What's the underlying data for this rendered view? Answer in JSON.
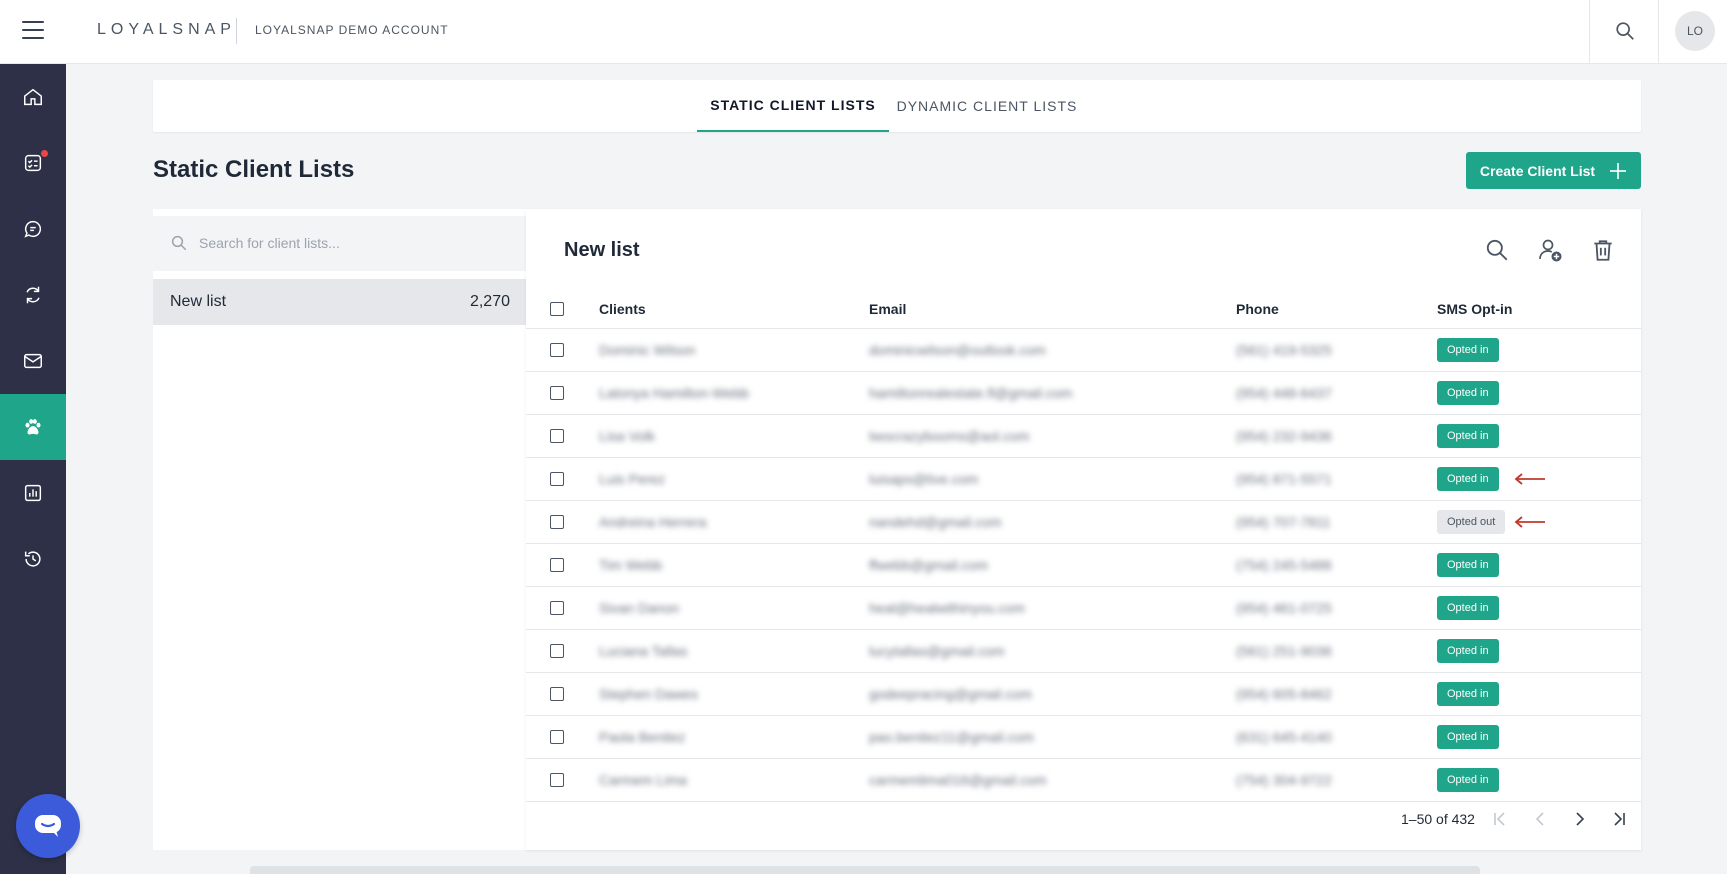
{
  "header": {
    "brand": "LOYALSNAP",
    "account_name": "LOYALSNAP DEMO ACCOUNT",
    "avatar_initials": "LO"
  },
  "sidebar": {
    "items": [
      {
        "name": "home",
        "icon": "home-icon",
        "active": false
      },
      {
        "name": "tasks",
        "icon": "checklist-icon",
        "active": false,
        "notification": true
      },
      {
        "name": "messages",
        "icon": "chat-icon",
        "active": false
      },
      {
        "name": "automations",
        "icon": "refresh-icon",
        "active": false
      },
      {
        "name": "email",
        "icon": "mail-icon",
        "active": false
      },
      {
        "name": "clients",
        "icon": "paw-icon",
        "active": true
      },
      {
        "name": "reports",
        "icon": "bar-chart-icon",
        "active": false
      },
      {
        "name": "history",
        "icon": "history-icon",
        "active": false
      }
    ]
  },
  "tabs": [
    {
      "label": "STATIC CLIENT LISTS",
      "active": true
    },
    {
      "label": "DYNAMIC CLIENT LISTS",
      "active": false
    }
  ],
  "page": {
    "title": "Static Client Lists",
    "create_button_label": "Create Client List"
  },
  "left_panel": {
    "search_placeholder": "Search for client lists...",
    "lists": [
      {
        "name": "New list",
        "count": "2,270"
      }
    ]
  },
  "table": {
    "title": "New list",
    "columns": [
      "Clients",
      "Email",
      "Phone",
      "SMS Opt-in"
    ],
    "rows": [
      {
        "client": "Dominic Wilson",
        "email": "dominicwilson@outlook.com",
        "phone": "(561) 419-5325",
        "sms": "Opted in",
        "arrow": false
      },
      {
        "client": "Latonya Hamilton-Webb",
        "email": "hamiltonrealestate.fl@gmail.com",
        "phone": "(954) 448-6437",
        "sms": "Opted in",
        "arrow": false
      },
      {
        "client": "Lisa Volk",
        "email": "twocrazybooms@aol.com",
        "phone": "(954) 232-9436",
        "sms": "Opted in",
        "arrow": false
      },
      {
        "client": "Luis Perez",
        "email": "luisaps@live.com",
        "phone": "(954) 871-5571",
        "sms": "Opted in",
        "arrow": true
      },
      {
        "client": "Andreina Herrera",
        "email": "nandehd@gmail.com",
        "phone": "(954) 707-7811",
        "sms": "Opted out",
        "arrow": true
      },
      {
        "client": "Tim Webb",
        "email": "ffwebb@gmail.com",
        "phone": "(754) 245-5486",
        "sms": "Opted in",
        "arrow": false
      },
      {
        "client": "Sivan Danon",
        "email": "heal@healwithinyou.com",
        "phone": "(954) 461-0725",
        "sms": "Opted in",
        "arrow": false
      },
      {
        "client": "Luciana Tallas",
        "email": "lucytallas@gmail.com",
        "phone": "(561) 251-9036",
        "sms": "Opted in",
        "arrow": false
      },
      {
        "client": "Stephen Dawes",
        "email": "godeepracing@gmail.com",
        "phone": "(954) 605-8462",
        "sms": "Opted in",
        "arrow": false
      },
      {
        "client": "Paola Benitez",
        "email": "pao.benitez11@gmail.com",
        "phone": "(631) 645-4140",
        "sms": "Opted in",
        "arrow": false
      },
      {
        "client": "Carmem Lima",
        "email": "carmemlima016@gmail.com",
        "phone": "(754) 304-9722",
        "sms": "Opted in",
        "arrow": false
      }
    ]
  },
  "pagination": {
    "range_text": "1–50 of 432"
  },
  "colors": {
    "accent": "#1fa58a",
    "sidebar_bg": "#2d3047",
    "arrow": "#c0392b",
    "chat_bubble": "#3b5bdb"
  }
}
